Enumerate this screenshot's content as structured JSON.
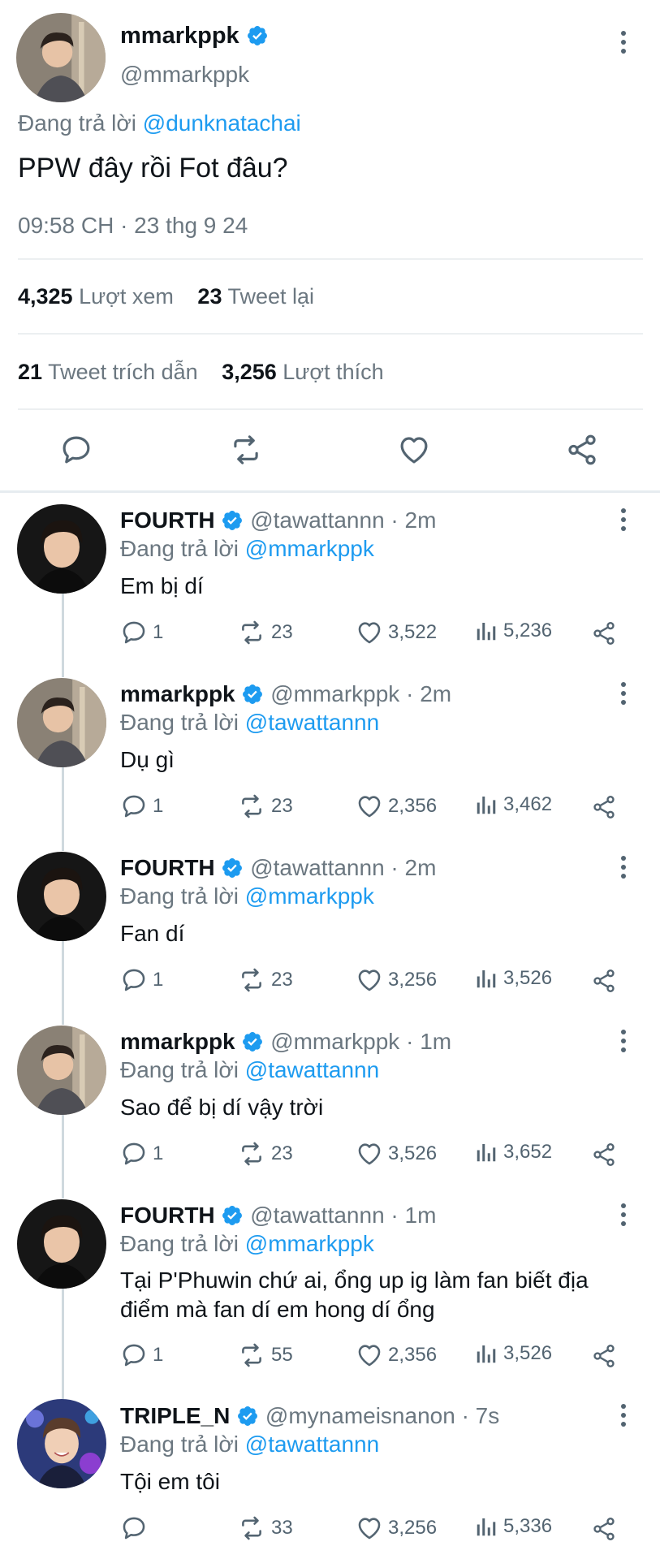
{
  "main_tweet": {
    "display_name": "mmarkppk",
    "handle": "@mmarkppk",
    "reply_prefix": "Đang trả lời",
    "reply_to": "@dunknatachai",
    "text": "PPW đây rồi Fot đâu?",
    "timestamp": "09:58 CH · 23 thg 9 24",
    "views_count": "4,325",
    "views_label": "Lượt xem",
    "retweets_count": "23",
    "retweets_label": "Tweet lại",
    "quotes_count": "21",
    "quotes_label": "Tweet trích dẫn",
    "likes_count": "3,256",
    "likes_label": "Lượt thích"
  },
  "replies": [
    {
      "name": "FOURTH",
      "handle": "@tawattannn",
      "time": "· 2m",
      "reply_prefix": "Đang trả lời",
      "reply_to": "@mmarkppk",
      "text": "Em bị dí",
      "replies": "1",
      "retweets": "23",
      "likes": "3,522",
      "views": "5,236"
    },
    {
      "name": "mmarkppk",
      "handle": "@mmarkppk",
      "time": "· 2m",
      "reply_prefix": "Đang trả lời",
      "reply_to": "@tawattannn",
      "text": "Dụ gì",
      "replies": "1",
      "retweets": "23",
      "likes": "2,356",
      "views": "3,462"
    },
    {
      "name": "FOURTH",
      "handle": "@tawattannn",
      "time": "· 2m",
      "reply_prefix": "Đang trả lời",
      "reply_to": "@mmarkppk",
      "text": "Fan dí",
      "replies": "1",
      "retweets": "23",
      "likes": "3,256",
      "views": "3,526"
    },
    {
      "name": "mmarkppk",
      "handle": "@mmarkppk",
      "time": "· 1m",
      "reply_prefix": "Đang trả lời",
      "reply_to": "@tawattannn",
      "text": "Sao để bị dí vậy trời",
      "replies": "1",
      "retweets": "23",
      "likes": "3,526",
      "views": "3,652"
    },
    {
      "name": "FOURTH",
      "handle": "@tawattannn",
      "time": "· 1m",
      "reply_prefix": "Đang trả lời",
      "reply_to": "@mmarkppk",
      "text_line1": "Tại P'Phuwin chứ ai, ổng up ig làm fan biết địa",
      "text_line2": "điểm mà fan dí em hong dí ổng",
      "replies": "1",
      "retweets": "55",
      "likes": "2,356",
      "views": "3,526"
    },
    {
      "name": "TRIPLE_N",
      "handle": "@mynameisnanon",
      "time": "· 7s",
      "reply_prefix": "Đang trả lời",
      "reply_to": "@tawattannn",
      "text": "Tội em tôi",
      "replies": "",
      "retweets": "33",
      "likes": "3,256",
      "views": "5,336"
    }
  ],
  "colors": {
    "accent": "#1d9bf0",
    "verified": "#1d9bf0",
    "muted": "#6b7780",
    "divider": "#eceff1"
  },
  "icons": [
    "verified-badge-icon",
    "more-options-icon",
    "reply-icon",
    "retweet-icon",
    "like-icon",
    "share-icon",
    "views-icon"
  ]
}
